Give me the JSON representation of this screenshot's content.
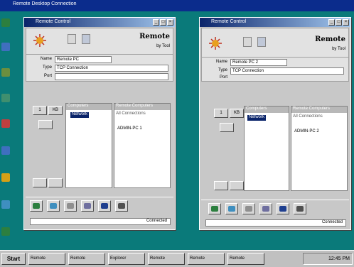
{
  "background_window": {
    "title": "Remote Desktop Connection"
  },
  "left_window": {
    "title": "Remote Control",
    "header": {
      "product": "Remote",
      "byline": "by Tool"
    },
    "fields": [
      {
        "label": "Name",
        "value": "Remote PC"
      },
      {
        "label": "Type",
        "value": "TCP Connection"
      },
      {
        "label": "Port",
        "value": ""
      }
    ],
    "side_buttons": [
      "1",
      "KB"
    ],
    "tree": {
      "header": "Computers",
      "selected": "Network"
    },
    "list": {
      "header": "Remote Computers",
      "subheader": "All Connections",
      "item": "ADMIN-PC 1"
    },
    "status": "Connected"
  },
  "right_window": {
    "title": "Remote Control",
    "header": {
      "product": "Remote",
      "byline": "by Tool"
    },
    "fields": [
      {
        "label": "Name",
        "value": "Remote PC 2"
      },
      {
        "label": "Type",
        "value": "TCP Connection"
      },
      {
        "label": "Port",
        "value": ""
      }
    ],
    "side_buttons": [
      "1",
      "KB"
    ],
    "tree": {
      "header": "Computers",
      "selected": "Network"
    },
    "list": {
      "header": "Remote Computers",
      "subheader": "All Connections",
      "item": "ADMIN-PC 2"
    },
    "status": "Connected"
  },
  "taskbar": {
    "start_label": "Start",
    "items": [
      "Remote",
      "Remote",
      "Explorer",
      "Remote",
      "Remote",
      "Remote"
    ],
    "clock": "12:45 PM"
  },
  "colors": {
    "desktop": "#0a7a7a",
    "titlebar": "#0a246a",
    "accent": "#0a246a"
  }
}
